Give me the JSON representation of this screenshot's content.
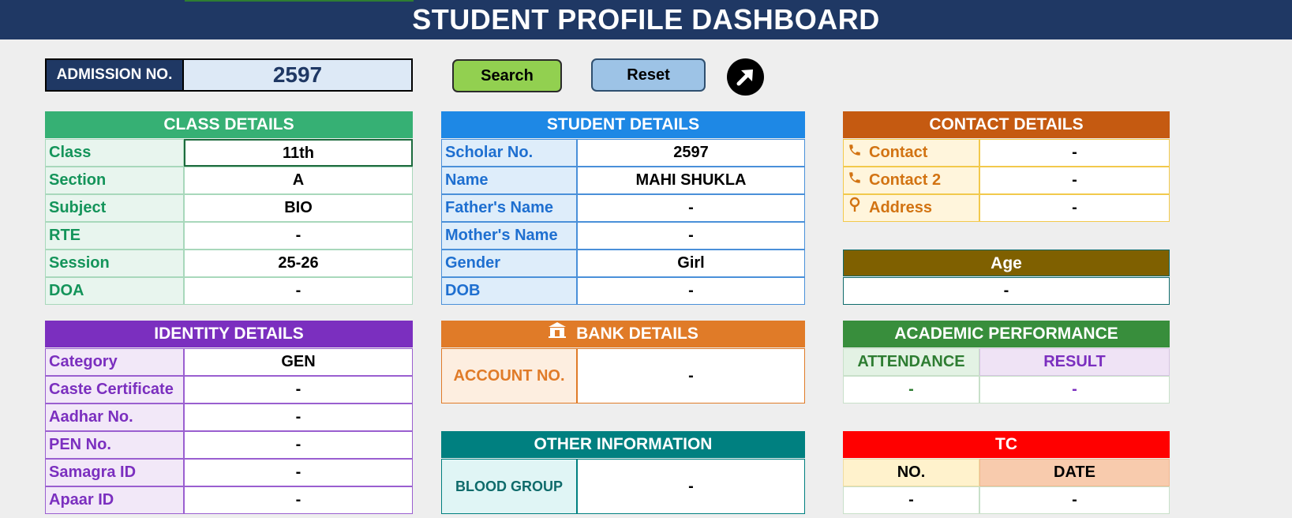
{
  "title": "STUDENT PROFILE DASHBOARD",
  "admission": {
    "label": "ADMISSION NO.",
    "value": "2597"
  },
  "buttons": {
    "search": "Search",
    "reset": "Reset",
    "go_icon": "arrow-up-right-icon"
  },
  "class_details": {
    "header": "CLASS DETAILS",
    "color": "#36b074",
    "rows": [
      {
        "label": "Class",
        "value": "11th"
      },
      {
        "label": "Section",
        "value": "A"
      },
      {
        "label": "Subject",
        "value": "BIO"
      },
      {
        "label": "RTE",
        "value": "-"
      },
      {
        "label": "Session",
        "value": "25-26"
      },
      {
        "label": "DOA",
        "value": "-"
      }
    ]
  },
  "student_details": {
    "header": "STUDENT DETAILS",
    "color": "#1e88e5",
    "rows": [
      {
        "label": "Scholar No.",
        "value": "2597"
      },
      {
        "label": "Name",
        "value": "MAHI SHUKLA"
      },
      {
        "label": "Father's Name",
        "value": "-"
      },
      {
        "label": "Mother's Name",
        "value": "-"
      },
      {
        "label": "Gender",
        "value": "Girl"
      },
      {
        "label": "DOB",
        "value": "-"
      }
    ]
  },
  "contact_details": {
    "header": "CONTACT DETAILS",
    "color": "#c55a11",
    "rows": [
      {
        "label": "Contact",
        "value": "-",
        "icon": "phone-icon"
      },
      {
        "label": "Contact 2",
        "value": "-",
        "icon": "phone-icon"
      },
      {
        "label": "Address",
        "value": "-",
        "icon": "location-pin-icon"
      }
    ]
  },
  "age": {
    "header": "Age",
    "value": "-",
    "color": "#7f6000"
  },
  "identity_details": {
    "header": "IDENTITY DETAILS",
    "color": "#7b2fbf",
    "rows": [
      {
        "label": "Category",
        "value": "GEN"
      },
      {
        "label": "Caste Certificate",
        "value": "-"
      },
      {
        "label": "Aadhar No.",
        "value": "-"
      },
      {
        "label": "PEN No.",
        "value": "-"
      },
      {
        "label": "Samagra ID",
        "value": "-"
      },
      {
        "label": "Apaar ID",
        "value": "-"
      }
    ]
  },
  "bank_details": {
    "header": "BANK DETAILS",
    "icon": "bank-icon",
    "color": "#e07b28",
    "label": "ACCOUNT NO.",
    "value": "-"
  },
  "academic_performance": {
    "header": "ACADEMIC PERFORMANCE",
    "color": "#388e3c",
    "attendance_label": "ATTENDANCE",
    "result_label": "RESULT",
    "attendance_value": "-",
    "result_value": "-"
  },
  "other_information": {
    "header": "OTHER INFORMATION",
    "color": "#008080",
    "label": "BLOOD GROUP",
    "value": "-"
  },
  "tc": {
    "header": "TC",
    "color": "#ff0000",
    "no_label": "NO.",
    "date_label": "DATE",
    "no_value": "-",
    "date_value": "-"
  }
}
